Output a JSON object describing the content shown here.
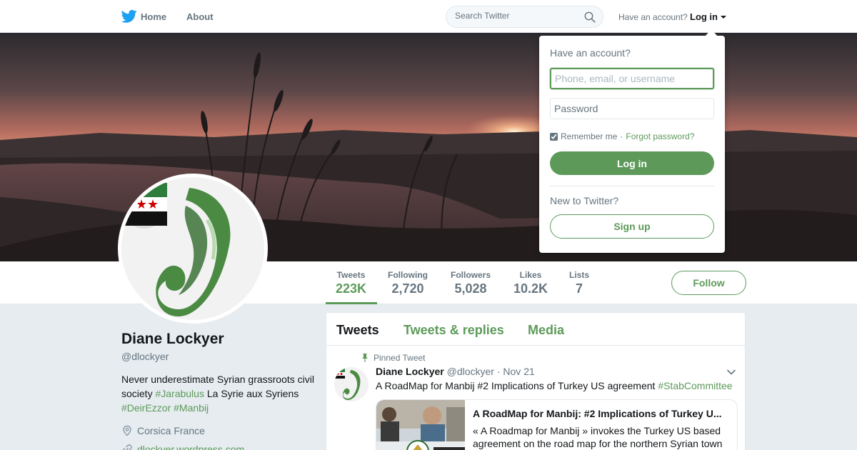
{
  "nav": {
    "home_label": "Home",
    "about_label": "About",
    "search_placeholder": "Search Twitter",
    "have_account": "Have an account?",
    "login_label": "Log in"
  },
  "profile": {
    "name": "Diane Lockyer",
    "handle": "@dlockyer",
    "bio_text1": "Never underestimate Syrian grassroots civil society ",
    "bio_tag1": "#Jarabulus",
    "bio_text2": " La Syrie aux Syriens ",
    "bio_tag2": "#DeirEzzor",
    "bio_tag3": "#Manbij",
    "location": "Corsica France",
    "website": "dlockyer.wordpress.com"
  },
  "stats": [
    {
      "label": "Tweets",
      "value": "223K"
    },
    {
      "label": "Following",
      "value": "2,720"
    },
    {
      "label": "Followers",
      "value": "5,028"
    },
    {
      "label": "Likes",
      "value": "10.2K"
    },
    {
      "label": "Lists",
      "value": "7"
    }
  ],
  "follow_label": "Follow",
  "timeline": {
    "tabs": [
      "Tweets",
      "Tweets & replies",
      "Media"
    ],
    "pinned_label": "Pinned Tweet",
    "tweet": {
      "name": "Diane Lockyer",
      "handle": "@dlockyer",
      "separator": "·",
      "date": "Nov 21",
      "text": "A RoadMap for Manbij #2 Implications of Turkey US agreement ",
      "hashtag": "#StabCommittee",
      "card_title": "A RoadMap for Manbij: #2 Implications of Turkey U...",
      "card_desc": " « A Roadmap for Manbij » invokes the Turkey US based agreement on the road map for the northern Syrian town"
    }
  },
  "login_dropdown": {
    "title": "Have an account?",
    "username_placeholder": "Phone, email, or username",
    "password_placeholder": "Password",
    "remember_label": "Remember me",
    "separator": "·",
    "forgot_label": "Forgot password?",
    "login_button": "Log in",
    "new_label": "New to Twitter?",
    "signup_button": "Sign up"
  },
  "colors": {
    "accent": "#5d9a5a",
    "text_secondary": "#66757f",
    "page_bg": "#e6ecf0"
  }
}
